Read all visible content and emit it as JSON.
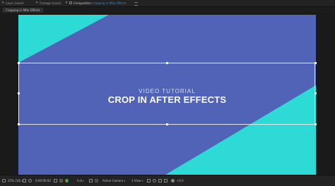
{
  "tabs": [
    {
      "label": "Layer (none)",
      "active": false
    },
    {
      "label": "Footage (none)",
      "active": false
    },
    {
      "prefix": "Composition ",
      "label": "Cropping in After Effects",
      "active": true
    }
  ],
  "breadcrumb": "Cropping in After Effects",
  "canvas": {
    "subtitle": "VIDEO TUTORIAL",
    "title": "CROP IN AFTER EFFECTS",
    "colors": {
      "background": "#5063b7",
      "accent": "#2ddad6"
    }
  },
  "bottombar": {
    "magnification": "25% (16)",
    "timecode": "0:00:00:00",
    "resolution": "Full",
    "camera": "Active Camera",
    "views": "1 View",
    "exposure": "+0.0"
  }
}
